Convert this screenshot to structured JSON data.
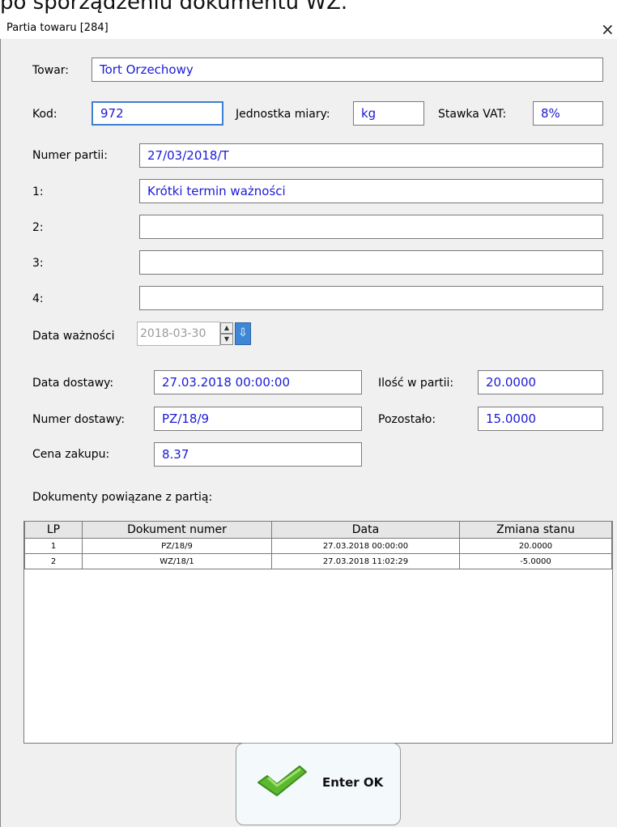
{
  "banner": "po sporządzeniu dokumentu WZ.",
  "window": {
    "title": "Partia towaru [284]",
    "close_icon": "×"
  },
  "fields": {
    "towar_label": "Towar:",
    "towar_value": "Tort Orzechowy",
    "kod_label": "Kod:",
    "kod_value": "972",
    "jm_label": "Jednostka miary:",
    "jm_value": "kg",
    "vat_label": "Stawka VAT:",
    "vat_value": "8%",
    "numer_partii_label": "Numer partii:",
    "numer_partii_value": "27/03/2018/T",
    "f1_label": "1:",
    "f1_value": "Krótki termin ważności",
    "f2_label": "2:",
    "f2_value": "",
    "f3_label": "3:",
    "f3_value": "",
    "f4_label": "4:",
    "f4_value": "",
    "data_waznosci_label": "Data ważności",
    "data_waznosci_value": "2018-03-30",
    "data_dostawy_label": "Data dostawy:",
    "data_dostawy_value": "27.03.2018 00:00:00",
    "ilosc_label": "Ilość w partii:",
    "ilosc_value": "20.0000",
    "numer_dostawy_label": "Numer dostawy:",
    "numer_dostawy_value": "PZ/18/9",
    "pozostalo_label": "Pozostało:",
    "pozostalo_value": "15.0000",
    "cena_label": "Cena zakupu:",
    "cena_value": "8.37"
  },
  "documents": {
    "title": "Dokumenty powiązane z partią:",
    "headers": [
      "LP",
      "Dokument numer",
      "Data",
      "Zmiana stanu"
    ],
    "rows": [
      [
        "1",
        "PZ/18/9",
        "27.03.2018 00:00:00",
        "20.0000"
      ],
      [
        "2",
        "WZ/18/1",
        "27.03.2018 11:02:29",
        "-5.0000"
      ]
    ]
  },
  "ok_button": {
    "label": "Enter OK"
  },
  "colors": {
    "value_text": "#1a1ad6",
    "check_green": "#5cb82e",
    "focus_border": "#3d7fd2"
  }
}
